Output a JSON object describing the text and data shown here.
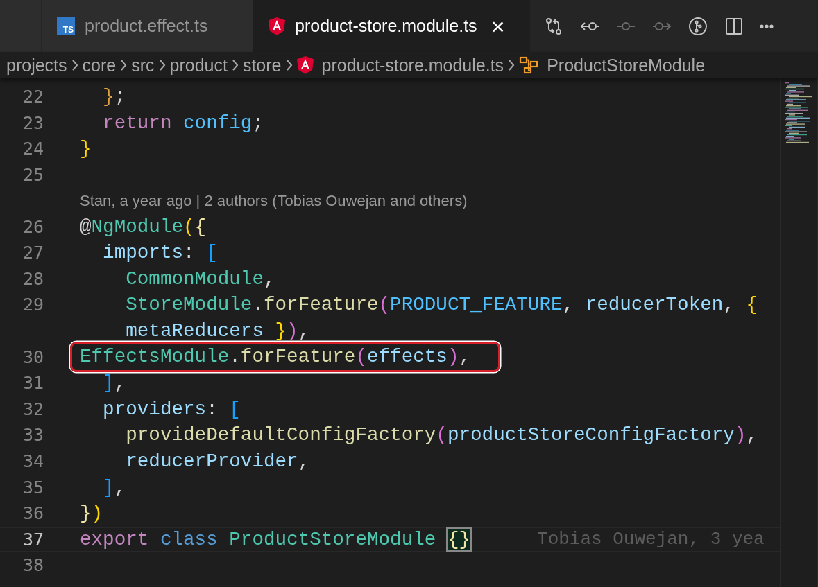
{
  "tabs": [
    {
      "label": "product.effect.ts",
      "icon_text": "TS",
      "selected": false
    },
    {
      "label": "product-store.module.ts",
      "selected": true,
      "close": "×"
    }
  ],
  "actions": [
    {
      "kind": "compare",
      "disabled": false
    },
    {
      "kind": "back",
      "disabled": false
    },
    {
      "kind": "commit",
      "disabled": true
    },
    {
      "kind": "forward",
      "disabled": true
    },
    {
      "kind": "branch",
      "disabled": false
    },
    {
      "kind": "split",
      "disabled": false
    },
    {
      "kind": "more",
      "disabled": false
    }
  ],
  "breadcrumbs": [
    {
      "label": "projects",
      "kind": "folder"
    },
    {
      "label": "core",
      "kind": "folder"
    },
    {
      "label": "src",
      "kind": "folder"
    },
    {
      "label": "product",
      "kind": "folder"
    },
    {
      "label": "store",
      "kind": "folder"
    },
    {
      "label": "product-store.module.ts",
      "kind": "file"
    },
    {
      "label": "ProductStoreModule",
      "kind": "symbol"
    }
  ],
  "lines": [
    {
      "number": "22",
      "tokens": [
        {
          "t": "  }",
          "color": "#e0a040"
        },
        {
          "t": ";",
          "color": "#d4d4d4"
        }
      ]
    },
    {
      "number": "23",
      "tokens": [
        {
          "t": "  return",
          "color": "#c586c0"
        },
        {
          "t": " config",
          "color": "#4fc1ff"
        },
        {
          "t": ";",
          "color": "#d4d4d4"
        }
      ]
    },
    {
      "number": "24",
      "tokens": [
        {
          "t": "}",
          "color": "#ffd700"
        }
      ]
    },
    {
      "number": "25"
    },
    {
      "number": "26",
      "codelens": "Stan, a year ago | 2 authors (Tobias Ouwejan and others)",
      "tokens": [
        {
          "t": "@",
          "color": "#d4d4d4"
        },
        {
          "t": "NgModule",
          "color": "#4ec9b0"
        },
        {
          "t": "(",
          "color": "#ffd700"
        },
        {
          "t": "{",
          "color": "#f1e6a6"
        }
      ]
    },
    {
      "number": "27",
      "tokens": [
        {
          "t": "  imports",
          "color": "#9cdcfe"
        },
        {
          "t": ": ",
          "color": "#d4d4d4"
        },
        {
          "t": "[",
          "color": "#179fff"
        }
      ]
    },
    {
      "number": "28",
      "tokens": [
        {
          "t": "    CommonModule",
          "color": "#4ec9b0"
        },
        {
          "t": ",",
          "color": "#d4d4d4"
        }
      ]
    },
    {
      "number": "29",
      "tokens": [
        {
          "t": "    StoreModule",
          "color": "#4ec9b0"
        },
        {
          "t": ".",
          "color": "#d4d4d4"
        },
        {
          "t": "forFeature",
          "color": "#dcdcaa"
        },
        {
          "t": "(",
          "color": "#da70d6"
        },
        {
          "t": "PRODUCT_FEATURE",
          "color": "#4fc1ff"
        },
        {
          "t": ", ",
          "color": "#d4d4d4"
        },
        {
          "t": "reducerToken",
          "color": "#9cdcfe"
        },
        {
          "t": ", ",
          "color": "#d4d4d4"
        },
        {
          "t": "{",
          "color": "#ffd700"
        }
      ],
      "wrap": [
        {
          "t": "    metaReducers",
          "color": "#9cdcfe"
        },
        {
          "t": " }",
          "color": "#ffd700"
        },
        {
          "t": ")",
          "color": "#da70d6"
        },
        {
          "t": ",",
          "color": "#d4d4d4"
        }
      ]
    },
    {
      "number": "30",
      "highlighted": true,
      "tokens": [
        {
          "t": "EffectsModule",
          "color": "#4ec9b0"
        },
        {
          "t": ".",
          "color": "#d4d4d4"
        },
        {
          "t": "forFeature",
          "color": "#dcdcaa"
        },
        {
          "t": "(",
          "color": "#da70d6"
        },
        {
          "t": "effects",
          "color": "#9cdcfe"
        },
        {
          "t": ")",
          "color": "#da70d6"
        },
        {
          "t": ",",
          "color": "#d4d4d4"
        }
      ]
    },
    {
      "number": "31",
      "tokens": [
        {
          "t": "  ]",
          "color": "#179fff"
        },
        {
          "t": ",",
          "color": "#d4d4d4"
        }
      ]
    },
    {
      "number": "32",
      "tokens": [
        {
          "t": "  providers",
          "color": "#9cdcfe"
        },
        {
          "t": ": ",
          "color": "#d4d4d4"
        },
        {
          "t": "[",
          "color": "#179fff"
        }
      ]
    },
    {
      "number": "33",
      "tokens": [
        {
          "t": "    provideDefaultConfigFactory",
          "color": "#dcdcaa"
        },
        {
          "t": "(",
          "color": "#da70d6"
        },
        {
          "t": "productStoreConfigFactory",
          "color": "#9cdcfe"
        },
        {
          "t": ")",
          "color": "#da70d6"
        },
        {
          "t": ",",
          "color": "#d4d4d4"
        }
      ]
    },
    {
      "number": "34",
      "tokens": [
        {
          "t": "    reducerProvider",
          "color": "#9cdcfe"
        },
        {
          "t": ",",
          "color": "#d4d4d4"
        }
      ]
    },
    {
      "number": "35",
      "tokens": [
        {
          "t": "  ]",
          "color": "#179fff"
        },
        {
          "t": ",",
          "color": "#d4d4d4"
        }
      ]
    },
    {
      "number": "36",
      "tokens": [
        {
          "t": "}",
          "color": "#f1e6a6"
        },
        {
          "t": ")",
          "color": "#ffd700"
        }
      ]
    },
    {
      "number": "37",
      "current": true,
      "blame": "Tobias Ouwejan, 3 yea",
      "tokens": [
        {
          "t": "export",
          "color": "#c586c0"
        },
        {
          "t": " class",
          "color": "#569cd6"
        },
        {
          "t": " ProductStoreModule ",
          "color": "#4ec9b0"
        },
        {
          "t": "{}",
          "color": "#f1e6a6",
          "matched": true
        }
      ]
    },
    {
      "number": "38"
    }
  ]
}
